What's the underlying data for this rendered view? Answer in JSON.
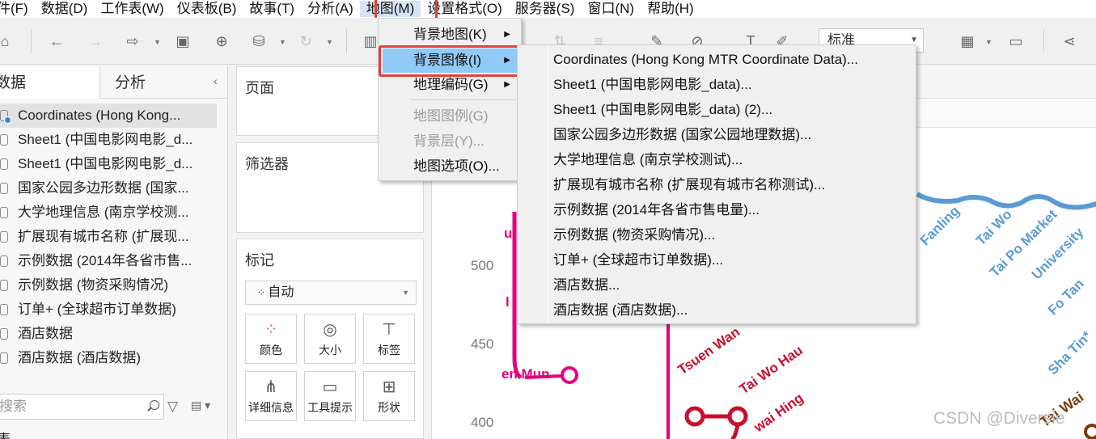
{
  "menubar": {
    "items": [
      "件(F)",
      "数据(D)",
      "工作表(W)",
      "仪表板(B)",
      "故事(T)",
      "分析(A)",
      "地图(M)",
      "设置格式(O)",
      "服务器(S)",
      "窗口(N)",
      "帮助(H)"
    ],
    "active_index": 6
  },
  "toolbar": {
    "fit_select_value": "标准"
  },
  "data_pane": {
    "tabs": [
      "数据",
      "分析"
    ],
    "datasources": [
      "Coordinates (Hong Kong...",
      "Sheet1 (中国电影网电影_d...",
      "Sheet1 (中国电影网电影_d...",
      "国家公园多边形数据 (国家...",
      "大学地理信息 (南京学校测...",
      "扩展现有城市名称 (扩展现...",
      "示例数据 (2014年各省市售...",
      "示例数据 (物资采购情况)",
      "订单+ (全球超市订单数据)",
      "酒店数据",
      "酒店数据 (酒店数据)"
    ],
    "search_placeholder": "搜索",
    "bottom_label": "表"
  },
  "shelves": {
    "pages_title": "页面",
    "filters_title": "筛选器",
    "marks_title": "标记",
    "marks_type": "自动",
    "mark_buttons": [
      "颜色",
      "大小",
      "标签",
      "详细信息",
      "工具提示",
      "形状"
    ]
  },
  "map_menu": {
    "items": [
      {
        "label": "背景地图(K)",
        "submenu": true,
        "enabled": true
      },
      {
        "label": "背景图像(I)",
        "submenu": true,
        "enabled": true
      },
      {
        "label": "地理编码(G)",
        "submenu": true,
        "enabled": true
      },
      {
        "label": "地图图例(G)",
        "submenu": false,
        "enabled": false
      },
      {
        "label": "背景层(Y)...",
        "submenu": false,
        "enabled": false
      },
      {
        "label": "地图选项(O)...",
        "submenu": false,
        "enabled": true
      }
    ],
    "hover_index": 1
  },
  "background_image_submenu": [
    "Coordinates (Hong Kong MTR Coordinate Data)...",
    "Sheet1 (中国电影网电影_data)...",
    "Sheet1 (中国电影网电影_data) (2)...",
    "国家公园多边形数据 (国家公园地理数据)...",
    "大学地理信息 (南京学校测试)...",
    "扩展现有城市名称 (扩展现有城市名称测试)...",
    "示例数据 (2014年各省市售电量)...",
    "示例数据 (物资采购情况)...",
    "订单+ (全球超市订单数据)...",
    "酒店数据...",
    "酒店数据 (酒店数据)..."
  ],
  "map": {
    "y_ticks": [
      "500",
      "450",
      "400"
    ],
    "station_labels": {
      "tuen_mun": "en Mun",
      "tsuen_wan": "Tsuen Wan",
      "tai_wo_hau": "Tai Wo Hau",
      "kwai_hing": "wai Hing",
      "fanling": "Fanling",
      "tai_wo": "Tai Wo",
      "tai_po_market": "Tai Po Market",
      "university": "University",
      "fo_tan": "Fo Tan",
      "sha_tin": "Sha Tin*",
      "tai_wai": "Tai Wai",
      "partial_u": "u",
      "partial_l": "l"
    },
    "colors": {
      "west_rail": "#e6007e",
      "tsuen_wan_line": "#c8102e",
      "east_rail": "#5b9bd5",
      "tai_wai_text": "#7a3b10"
    }
  },
  "watermark": "CSDN @Diversie"
}
